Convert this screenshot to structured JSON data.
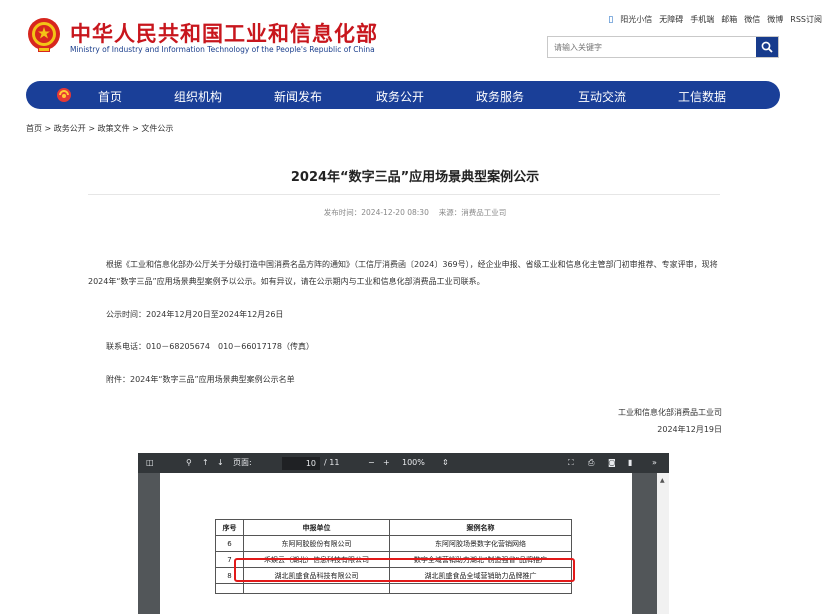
{
  "header": {
    "title_cn": "中华人民共和国工业和信息化部",
    "title_en": "Ministry of Industry and Information Technology of the People's Republic of China",
    "top_links": [
      "阳光小信",
      "无障碍",
      "手机端",
      "邮箱",
      "微信",
      "微博",
      "RSS订阅"
    ],
    "search_placeholder": "请输入关键字"
  },
  "nav": {
    "items": [
      "首页",
      "组织机构",
      "新闻发布",
      "政务公开",
      "政务服务",
      "互动交流",
      "工信数据"
    ]
  },
  "breadcrumb": "首页 > 政务公开 > 政策文件 > 文件公示",
  "article": {
    "title": "2024年“数字三品”应用场景典型案例公示",
    "meta": "发布时间：2024-12-20 08:30　 来源：消费品工业司",
    "paragraph": "根据《工业和信息化部办公厅关于分级打造中国消费名品方阵的通知》（工信厅消费函〔2024〕369号），经企业申报、省级工业和信息化主管部门初审推荐、专家评审，现将2024年“数字三品”应用场景典型案例予以公示。如有异议，请在公示期内与工业和信息化部消费品工业司联系。",
    "period": "公示时间：2024年12月20日至2024年12月26日",
    "phone": "联系电话：010－68205674　010－66017178（传真）",
    "attachment": "附件：2024年“数字三品”应用场景典型案例公示名单",
    "signer": "工业和信息化部消费品工业司",
    "date": "2024年12月19日"
  },
  "pdf_viewer": {
    "page_label": "页面:",
    "page_current": "10",
    "page_total": "/ 11",
    "zoom": "100%",
    "table_headers": [
      "序号",
      "申报单位",
      "案例名称"
    ],
    "rows": [
      [
        "6",
        "东阿阿胶股份有限公司",
        "东阿阿胶场景数字化营销网络"
      ],
      [
        "7",
        "禾娱云（湖北）信息科技有限公司",
        "数字全域营销助力湖北“制造强省”品牌推广"
      ],
      [
        "8",
        "湖北凯盛食品科技有限公司",
        "湖北凯盛食品全域营销助力品牌推广"
      ]
    ]
  },
  "colors": {
    "brand_red": "#c8161d",
    "nav_blue": "#1a3f98",
    "highlight_red": "#e21a1a"
  }
}
